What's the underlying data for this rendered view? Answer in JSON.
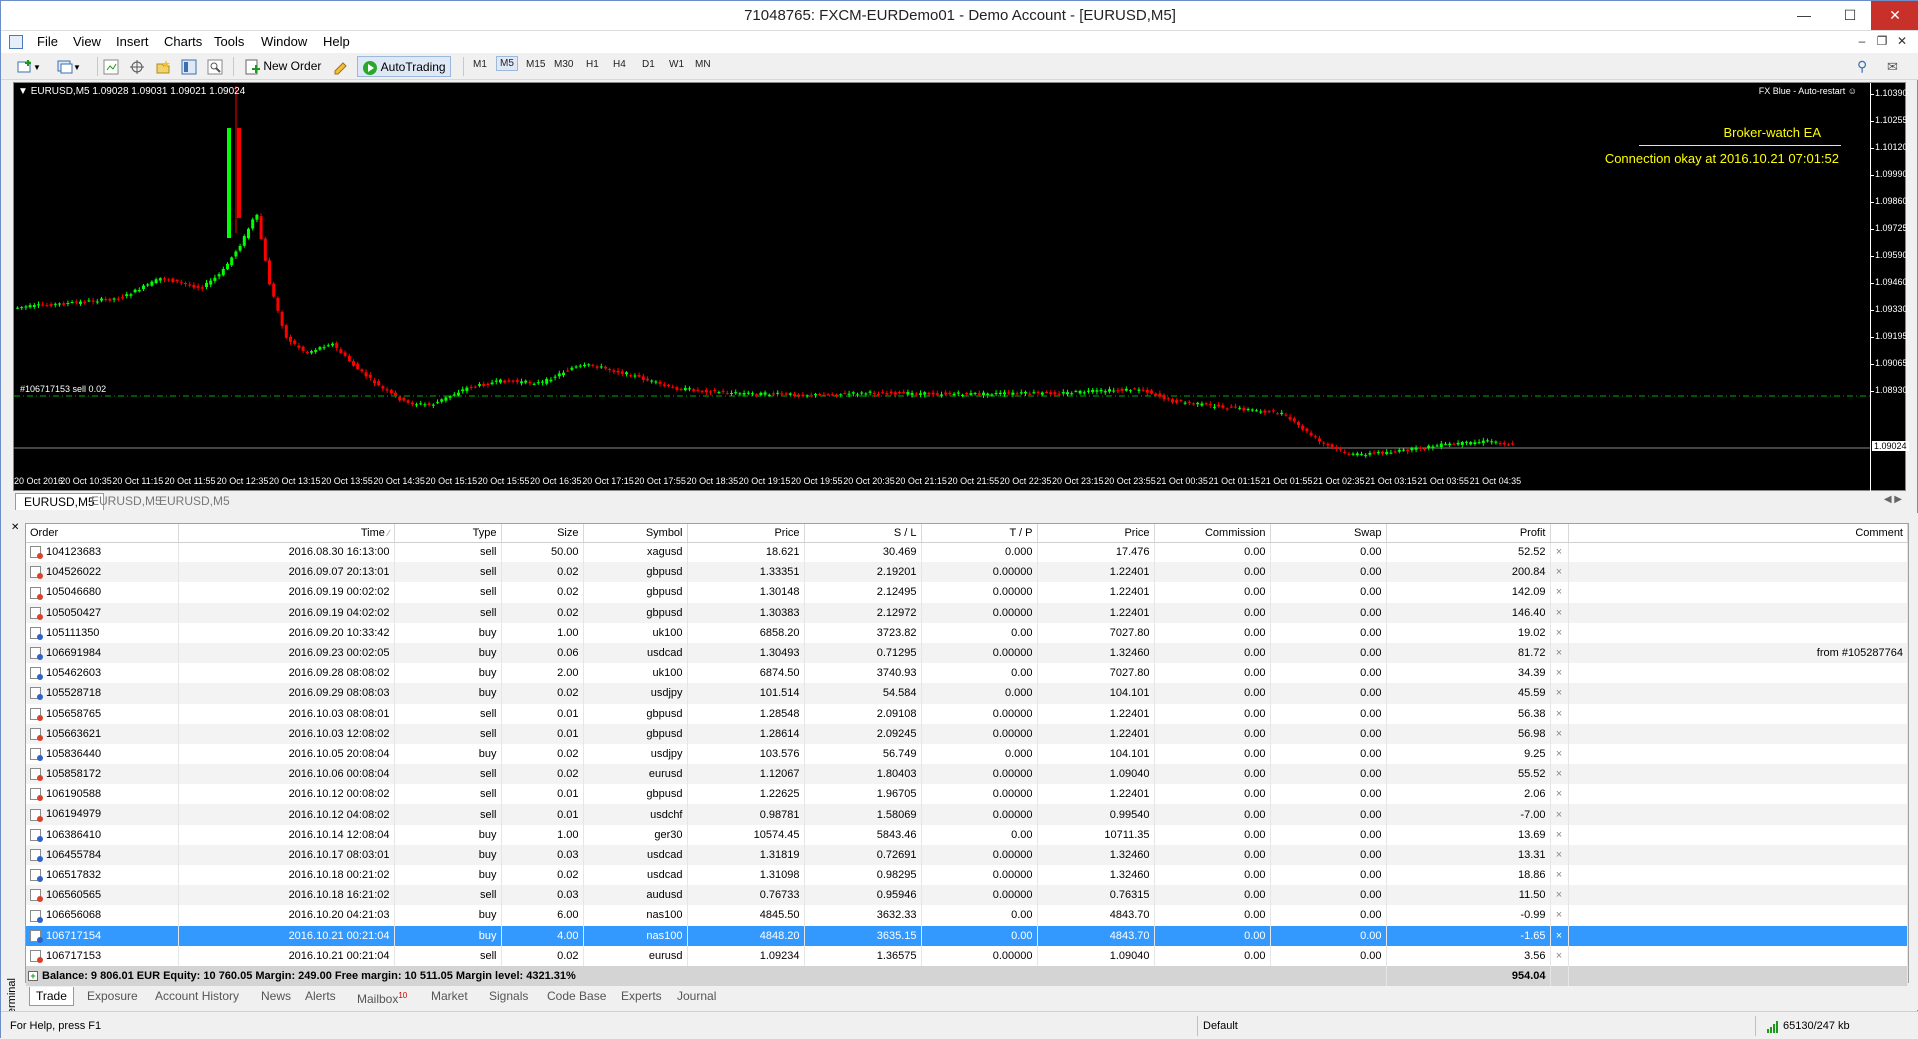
{
  "window": {
    "title": "71048765: FXCM-EURDemo01 - Demo Account - [EURUSD,M5]"
  },
  "menu": [
    "File",
    "View",
    "Insert",
    "Charts",
    "Tools",
    "Window",
    "Help"
  ],
  "toolbar": {
    "new_order": "New Order",
    "autotrading": "AutoTrading",
    "timeframes": [
      "M1",
      "M5",
      "M15",
      "M30",
      "H1",
      "H4",
      "D1",
      "W1",
      "MN"
    ],
    "active_timeframe": "M5"
  },
  "chart": {
    "header": "EURUSD,M5  1.09028 1.09031 1.09021 1.09024",
    "ea_name": "FX Blue - Auto-restart",
    "broker_watch": "Broker-watch EA",
    "connection": "Connection okay at 2016.10.21 07:01:52",
    "order_label": "#106717153 sell 0.02",
    "current_price": "1.09024",
    "price_ticks": [
      "1.10390",
      "1.10255",
      "1.10120",
      "1.09990",
      "1.09860",
      "1.09725",
      "1.09590",
      "1.09460",
      "1.09330",
      "1.09195",
      "1.09065",
      "1.08930"
    ],
    "time_ticks": [
      "20 Oct 2016",
      "20 Oct 10:35",
      "20 Oct 11:15",
      "20 Oct 11:55",
      "20 Oct 12:35",
      "20 Oct 13:15",
      "20 Oct 13:55",
      "20 Oct 14:35",
      "20 Oct 15:15",
      "20 Oct 15:55",
      "20 Oct 16:35",
      "20 Oct 17:15",
      "20 Oct 17:55",
      "20 Oct 18:35",
      "20 Oct 19:15",
      "20 Oct 19:55",
      "20 Oct 20:35",
      "20 Oct 21:15",
      "20 Oct 21:55",
      "20 Oct 22:35",
      "20 Oct 23:15",
      "20 Oct 23:55",
      "21 Oct 00:35",
      "21 Oct 01:15",
      "21 Oct 01:55",
      "21 Oct 02:35",
      "21 Oct 03:15",
      "21 Oct 03:55",
      "21 Oct 04:35"
    ],
    "colors": {
      "bull": "#00ff00",
      "bear": "#ff0000",
      "background": "#000000",
      "text": "#ffffff",
      "ea_text": "#ffff00",
      "order_line": "#00aa00"
    }
  },
  "chart_tabs": [
    "EURUSD,M5",
    "EURUSD,M5",
    "EURUSD,M5"
  ],
  "terminal": {
    "columns": [
      "Order",
      "Time",
      "Type",
      "Size",
      "Symbol",
      "Price",
      "S / L",
      "T / P",
      "Price",
      "Commission",
      "Swap",
      "Profit",
      "",
      "Comment"
    ],
    "rows": [
      [
        "104123683",
        "2016.08.30 16:13:00",
        "sell",
        "50.00",
        "xagusd",
        "18.621",
        "30.469",
        "0.000",
        "17.476",
        "0.00",
        "0.00",
        "52.52",
        "×",
        ""
      ],
      [
        "104526022",
        "2016.09.07 20:13:01",
        "sell",
        "0.02",
        "gbpusd",
        "1.33351",
        "2.19201",
        "0.00000",
        "1.22401",
        "0.00",
        "0.00",
        "200.84",
        "×",
        ""
      ],
      [
        "105046680",
        "2016.09.19 00:02:02",
        "sell",
        "0.02",
        "gbpusd",
        "1.30148",
        "2.12495",
        "0.00000",
        "1.22401",
        "0.00",
        "0.00",
        "142.09",
        "×",
        ""
      ],
      [
        "105050427",
        "2016.09.19 04:02:02",
        "sell",
        "0.02",
        "gbpusd",
        "1.30383",
        "2.12972",
        "0.00000",
        "1.22401",
        "0.00",
        "0.00",
        "146.40",
        "×",
        ""
      ],
      [
        "105111350",
        "2016.09.20 10:33:42",
        "buy",
        "1.00",
        "uk100",
        "6858.20",
        "3723.82",
        "0.00",
        "7027.80",
        "0.00",
        "0.00",
        "19.02",
        "×",
        ""
      ],
      [
        "106691984",
        "2016.09.23 00:02:05",
        "buy",
        "0.06",
        "usdcad",
        "1.30493",
        "0.71295",
        "0.00000",
        "1.32460",
        "0.00",
        "0.00",
        "81.72",
        "×",
        "from #105287764"
      ],
      [
        "105462603",
        "2016.09.28 08:08:02",
        "buy",
        "2.00",
        "uk100",
        "6874.50",
        "3740.93",
        "0.00",
        "7027.80",
        "0.00",
        "0.00",
        "34.39",
        "×",
        ""
      ],
      [
        "105528718",
        "2016.09.29 08:08:03",
        "buy",
        "0.02",
        "usdjpy",
        "101.514",
        "54.584",
        "0.000",
        "104.101",
        "0.00",
        "0.00",
        "45.59",
        "×",
        ""
      ],
      [
        "105658765",
        "2016.10.03 08:08:01",
        "sell",
        "0.01",
        "gbpusd",
        "1.28548",
        "2.09108",
        "0.00000",
        "1.22401",
        "0.00",
        "0.00",
        "56.38",
        "×",
        ""
      ],
      [
        "105663621",
        "2016.10.03 12:08:02",
        "sell",
        "0.01",
        "gbpusd",
        "1.28614",
        "2.09245",
        "0.00000",
        "1.22401",
        "0.00",
        "0.00",
        "56.98",
        "×",
        ""
      ],
      [
        "105836440",
        "2016.10.05 20:08:04",
        "buy",
        "0.02",
        "usdjpy",
        "103.576",
        "56.749",
        "0.000",
        "104.101",
        "0.00",
        "0.00",
        "9.25",
        "×",
        ""
      ],
      [
        "105858172",
        "2016.10.06 00:08:04",
        "sell",
        "0.02",
        "eurusd",
        "1.12067",
        "1.80403",
        "0.00000",
        "1.09040",
        "0.00",
        "0.00",
        "55.52",
        "×",
        ""
      ],
      [
        "106190588",
        "2016.10.12 00:08:02",
        "sell",
        "0.01",
        "gbpusd",
        "1.22625",
        "1.96705",
        "0.00000",
        "1.22401",
        "0.00",
        "0.00",
        "2.06",
        "×",
        ""
      ],
      [
        "106194979",
        "2016.10.12 04:08:02",
        "sell",
        "0.01",
        "usdchf",
        "0.98781",
        "1.58069",
        "0.00000",
        "0.99540",
        "0.00",
        "0.00",
        "-7.00",
        "×",
        ""
      ],
      [
        "106386410",
        "2016.10.14 12:08:04",
        "buy",
        "1.00",
        "ger30",
        "10574.45",
        "5843.46",
        "0.00",
        "10711.35",
        "0.00",
        "0.00",
        "13.69",
        "×",
        ""
      ],
      [
        "106455784",
        "2016.10.17 08:03:01",
        "buy",
        "0.03",
        "usdcad",
        "1.31819",
        "0.72691",
        "0.00000",
        "1.32460",
        "0.00",
        "0.00",
        "13.31",
        "×",
        ""
      ],
      [
        "106517832",
        "2016.10.18 00:21:02",
        "buy",
        "0.02",
        "usdcad",
        "1.31098",
        "0.98295",
        "0.00000",
        "1.32460",
        "0.00",
        "0.00",
        "18.86",
        "×",
        ""
      ],
      [
        "106560565",
        "2016.10.18 16:21:02",
        "sell",
        "0.03",
        "audusd",
        "0.76733",
        "0.95946",
        "0.00000",
        "0.76315",
        "0.00",
        "0.00",
        "11.50",
        "×",
        ""
      ],
      [
        "106656068",
        "2016.10.20 04:21:03",
        "buy",
        "6.00",
        "nas100",
        "4845.50",
        "3632.33",
        "0.00",
        "4843.70",
        "0.00",
        "0.00",
        "-0.99",
        "×",
        ""
      ],
      [
        "106717154",
        "2016.10.21 00:21:04",
        "buy",
        "4.00",
        "nas100",
        "4848.20",
        "3635.15",
        "0.00",
        "4843.70",
        "0.00",
        "0.00",
        "-1.65",
        "×",
        ""
      ],
      [
        "106717153",
        "2016.10.21 00:21:04",
        "sell",
        "0.02",
        "eurusd",
        "1.09234",
        "1.36575",
        "0.00000",
        "1.09040",
        "0.00",
        "0.00",
        "3.56",
        "×",
        ""
      ]
    ],
    "selected_row": 19,
    "summary": "Balance: 9 806.01 EUR  Equity: 10 760.05  Margin: 249.00  Free margin: 10 511.05  Margin level: 4321.31%",
    "total_profit": "954.04",
    "side_label": "Terminal",
    "tabs": [
      "Trade",
      "Exposure",
      "Account History",
      "News",
      "Alerts",
      "Mailbox",
      "Market",
      "Signals",
      "Code Base",
      "Experts",
      "Journal"
    ],
    "mailbox_count": "10"
  },
  "status": {
    "help": "For Help, press F1",
    "profile": "Default",
    "connection": "65130/247 kb"
  }
}
